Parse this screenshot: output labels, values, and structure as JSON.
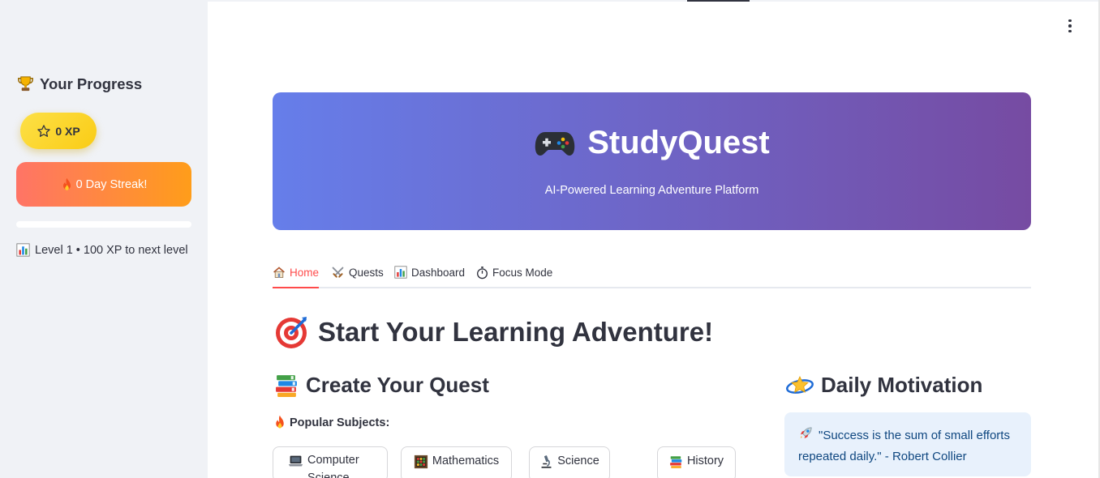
{
  "sidebar": {
    "title": "Your Progress",
    "title_icon": "trophy-icon",
    "xp_label": "0 XP",
    "xp_icon": "star-icon",
    "streak_label": "0 Day Streak!",
    "streak_icon": "fire-icon",
    "level_progress": 0.0,
    "level_text": "Level 1 • 100 XP to next level",
    "level_icon": "bar-chart-icon"
  },
  "hero": {
    "icon": "gamepad-icon",
    "title": "StudyQuest",
    "subtitle": "AI-Powered Learning Adventure Platform",
    "gradient_start": "#667eea",
    "gradient_end": "#764ba2"
  },
  "tabs": [
    {
      "label": "Home",
      "icon": "house-icon",
      "active": true
    },
    {
      "label": "Quests",
      "icon": "crossed-swords-icon",
      "active": false
    },
    {
      "label": "Dashboard",
      "icon": "bar-chart-icon",
      "active": false
    },
    {
      "label": "Focus Mode",
      "icon": "stopwatch-icon",
      "active": false
    }
  ],
  "main": {
    "heading": "Start Your Learning Adventure!",
    "heading_icon": "target-icon",
    "create_heading": "Create Your Quest",
    "create_icon": "books-icon",
    "popular_label": "Popular Subjects:",
    "popular_icon": "fire-icon",
    "subjects": [
      {
        "label": "Computer Science",
        "icon": "laptop-icon"
      },
      {
        "label": "Mathematics",
        "icon": "abacus-icon"
      },
      {
        "label": "Science",
        "icon": "microscope-icon"
      },
      {
        "label": "History",
        "icon": "books-icon"
      }
    ]
  },
  "motivation": {
    "heading": "Daily Motivation",
    "heading_icon": "dizzy-star-icon",
    "quote_icon": "rocket-icon",
    "quote": "\"Success is the sum of small efforts repeated daily.\" - Robert Collier"
  },
  "colors": {
    "accent": "#ff4b4b",
    "sidebar_bg": "#f0f2f6",
    "xp_yellow": "#fde047",
    "streak_start": "#ff7466",
    "streak_end": "#ff9d1a",
    "quote_bg": "#e8f1fc",
    "quote_text": "#0f4780"
  }
}
